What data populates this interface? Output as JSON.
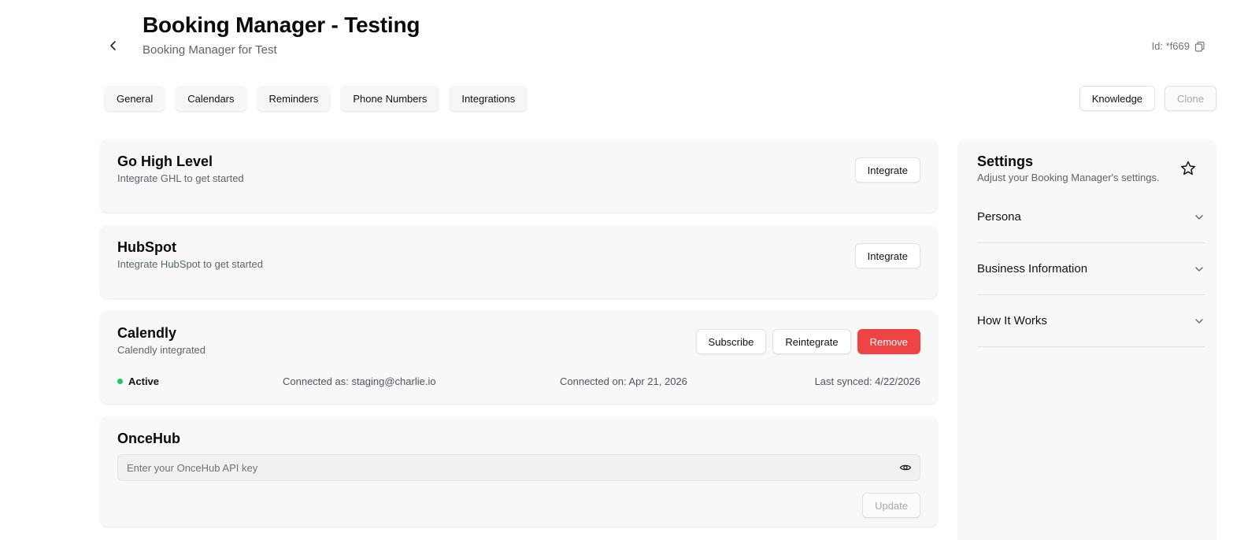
{
  "header": {
    "title": "Booking Manager - Testing",
    "subtitle": "Booking Manager for Test",
    "id_text": "Id: *f669"
  },
  "tabs": [
    {
      "label": "General"
    },
    {
      "label": "Calendars"
    },
    {
      "label": "Reminders"
    },
    {
      "label": "Phone Numbers"
    },
    {
      "label": "Integrations"
    }
  ],
  "top_actions": {
    "knowledge": "Knowledge",
    "clone": "Clone"
  },
  "integrations": {
    "ghl": {
      "title": "Go High Level",
      "desc": "Integrate GHL to get started",
      "button": "Integrate"
    },
    "hubspot": {
      "title": "HubSpot",
      "desc": "Integrate HubSpot to get started",
      "button": "Integrate"
    },
    "calendly": {
      "title": "Calendly",
      "desc": "Calendly integrated",
      "subscribe": "Subscribe",
      "reintegrate": "Reintegrate",
      "remove": "Remove",
      "status": "Active",
      "connected_as": "Connected as: staging@charlie.io",
      "connected_on": "Connected on: Apr 21, 2026",
      "last_synced": "Last synced: 4/22/2026"
    },
    "oncehub": {
      "title": "OnceHub",
      "api_value": "",
      "api_placeholder": "Enter your OnceHub API key",
      "update": "Update"
    }
  },
  "settings": {
    "title": "Settings",
    "desc": "Adjust your Booking Manager's settings.",
    "sections": [
      {
        "label": "Persona"
      },
      {
        "label": "Business Information"
      },
      {
        "label": "How It Works"
      }
    ]
  },
  "colors": {
    "accent_danger": "#ef4444",
    "status_active": "#22c55e"
  },
  "icons": {
    "back": "chevron-left-icon",
    "copy": "copy-icon",
    "eye": "eye-icon",
    "star": "star-icon",
    "chevron": "chevron-down-icon"
  }
}
